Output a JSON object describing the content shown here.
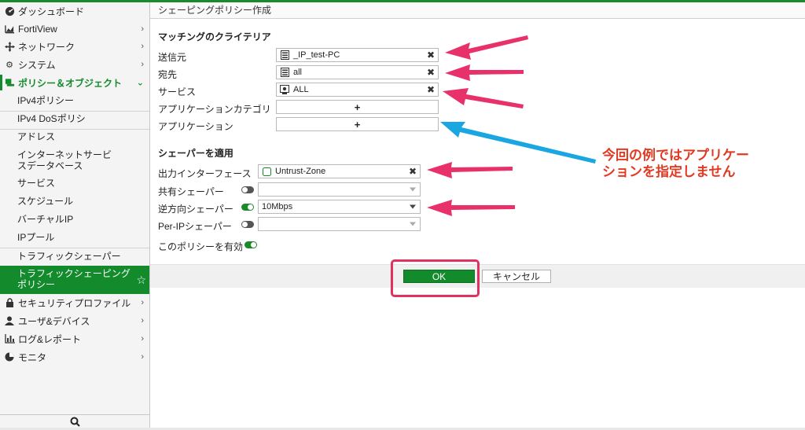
{
  "sidebar": {
    "items": [
      {
        "label": "ダッシュボード",
        "icon": "dashboard-icon"
      },
      {
        "label": "FortiView",
        "icon": "chart-icon"
      },
      {
        "label": "ネットワーク",
        "icon": "network-icon"
      },
      {
        "label": "システム",
        "icon": "gear-icon"
      },
      {
        "label": "ポリシー＆オブジェクト",
        "icon": "policy-icon"
      },
      {
        "label": "セキュリティプロファイル",
        "icon": "lock-icon"
      },
      {
        "label": "ユーザ&デバイス",
        "icon": "user-icon"
      },
      {
        "label": "ログ&レポート",
        "icon": "bar-chart-icon"
      },
      {
        "label": "モニタ",
        "icon": "pie-chart-icon"
      }
    ],
    "sub_items": [
      "IPv4ポリシー",
      "IPv4 DoSポリシ",
      "アドレス",
      "インターネットサービスデータベース",
      "サービス",
      "スケジュール",
      "バーチャルIP",
      "IPプール",
      "トラフィックシェーパー",
      "トラフィックシェーピングポリシー"
    ],
    "search_icon": "search-icon"
  },
  "main": {
    "title": "シェーピングポリシー作成",
    "matching_section": "マッチングのクライテリア",
    "fields": {
      "source_label": "送信元",
      "source_value": "_IP_test-PC",
      "dest_label": "宛先",
      "dest_value": "all",
      "service_label": "サービス",
      "service_value": "ALL",
      "app_category_label": "アプリケーションカテゴリ",
      "application_label": "アプリケーション",
      "plus": "+"
    },
    "shaper_section": "シェーパーを適用",
    "shaper": {
      "out_if_label": "出力インターフェース",
      "out_if_value": "Untrust-Zone",
      "shared_label": "共有シェーパー",
      "shared_enabled": false,
      "reverse_label": "逆方向シェーパー",
      "reverse_enabled": true,
      "reverse_value": "10Mbps",
      "perip_label": "Per-IPシェーパー",
      "perip_enabled": false
    },
    "enable_label": "このポリシーを有効",
    "enable_on": true,
    "ok_label": "OK",
    "cancel_label": "キャンセル"
  },
  "annotation": {
    "note": "今回の例ではアプリケーションを指定しません",
    "arrow_color": "#e8306a",
    "blue_arrow_color": "#1aa6e0"
  },
  "colors": {
    "accent": "#138a2b",
    "highlight": "#e0315f"
  }
}
